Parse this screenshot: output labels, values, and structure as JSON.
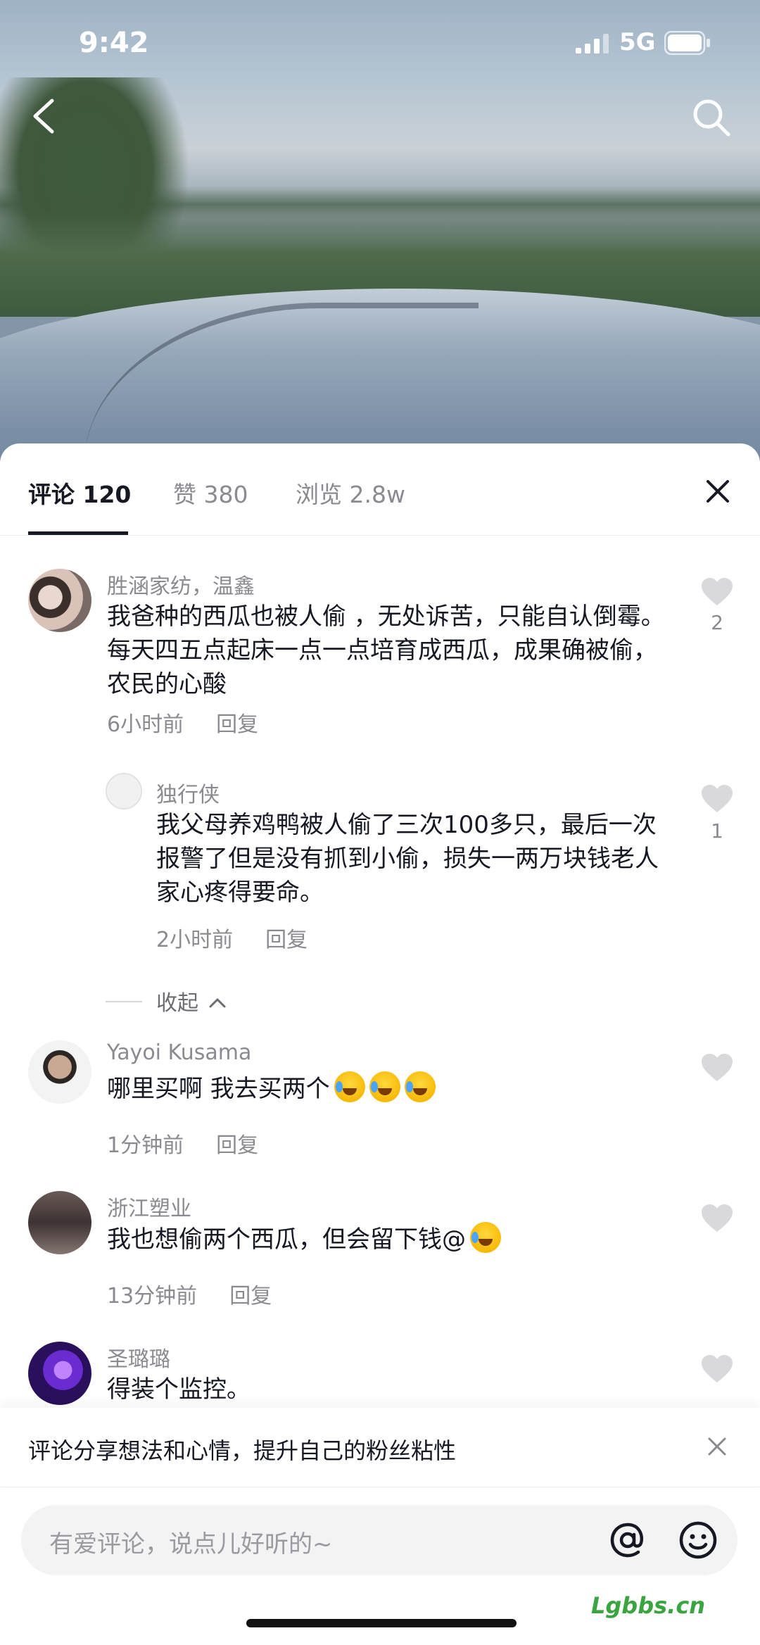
{
  "status_bar": {
    "time": "9:42",
    "network": "5G"
  },
  "tabs": {
    "comments": "评论 120",
    "likes": "赞 380",
    "views": "浏览 2.8w"
  },
  "comments": [
    {
      "author": "胜涵家纺，温鑫",
      "text": "我爸种的西瓜也被人偷 ，无处诉苦，只能自认倒霉。每天四五点起床一点一点培育成西瓜，成果确被偷，农民的心酸",
      "time": "6小时前",
      "reply_label": "回复",
      "likes": "2",
      "replies": [
        {
          "author": "独行侠",
          "text": "我父母养鸡鸭被人偷了三次100多只，最后一次报警了但是没有抓到小偷，损失一两万块钱老人家心疼得要命。",
          "time": "2小时前",
          "reply_label": "回复",
          "likes": "1"
        }
      ],
      "collapse_label": "收起"
    },
    {
      "author": "Yayoi Kusama",
      "text": "哪里买啊 我去买两个",
      "time": "1分钟前",
      "reply_label": "回复"
    },
    {
      "author": "浙江塑业",
      "text": "我也想偷两个西瓜，但会留下钱@",
      "time": "13分钟前",
      "reply_label": "回复"
    },
    {
      "author": "圣璐璐",
      "text": "得装个监控。"
    }
  ],
  "tip": {
    "text": "评论分享想法和心情，提升自己的粉丝粘性"
  },
  "input": {
    "placeholder": "有爱评论，说点儿好听的~"
  },
  "watermark": "Lgbbs.cn",
  "colors": {
    "accent": "#161823",
    "muted": "#8a8b91",
    "input_bg": "#f3f3f4"
  }
}
